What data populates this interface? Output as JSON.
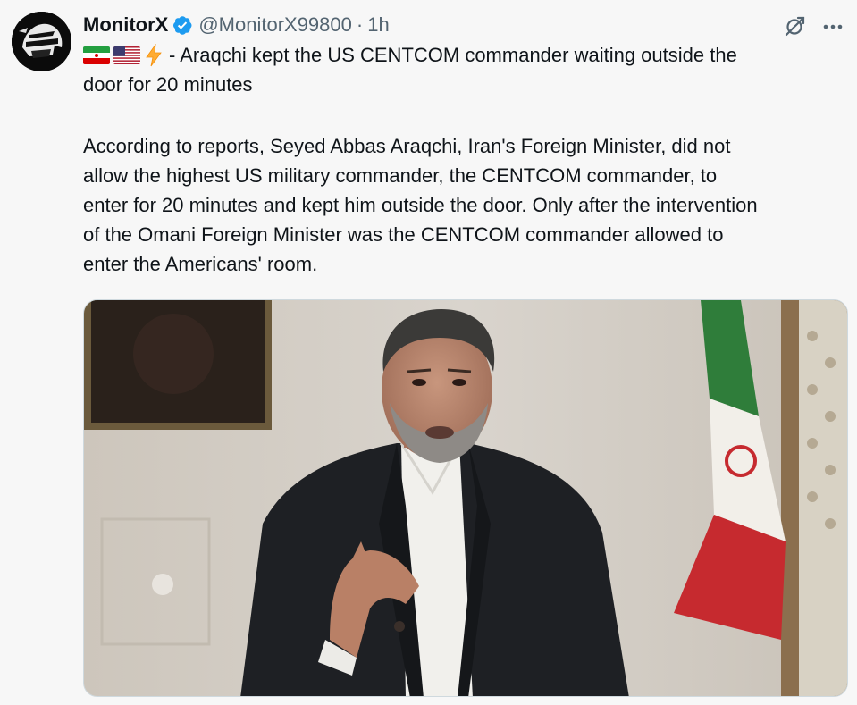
{
  "tweet": {
    "display_name": "MonitorX",
    "handle": "@MonitorX99800",
    "separator": "·",
    "time": "1h",
    "headline_emojis": [
      "iran-flag",
      "us-flag",
      "lightning-bolt"
    ],
    "headline_line1": "- Araqchi kept the US CENTCOM commander waiting outside the",
    "headline_line2": "door for 20 minutes",
    "body_lines": [
      "According to reports, Seyed Abbas Araqchi, Iran's Foreign Minister, did not",
      "allow the highest US military commander, the CENTCOM commander, to",
      "enter for 20 minutes and kept him outside the door. Only after the intervention",
      "of the Omani Foreign Minister was the CENTCOM commander allowed to",
      "enter the Americans' room."
    ],
    "icons": {
      "verified": "verified-badge-icon",
      "grok": "grok-icon",
      "more": "more-options-icon"
    },
    "colors": {
      "verified_blue": "#1d9bf0",
      "secondary_text": "#536471",
      "background": "#f7f7f7"
    }
  }
}
